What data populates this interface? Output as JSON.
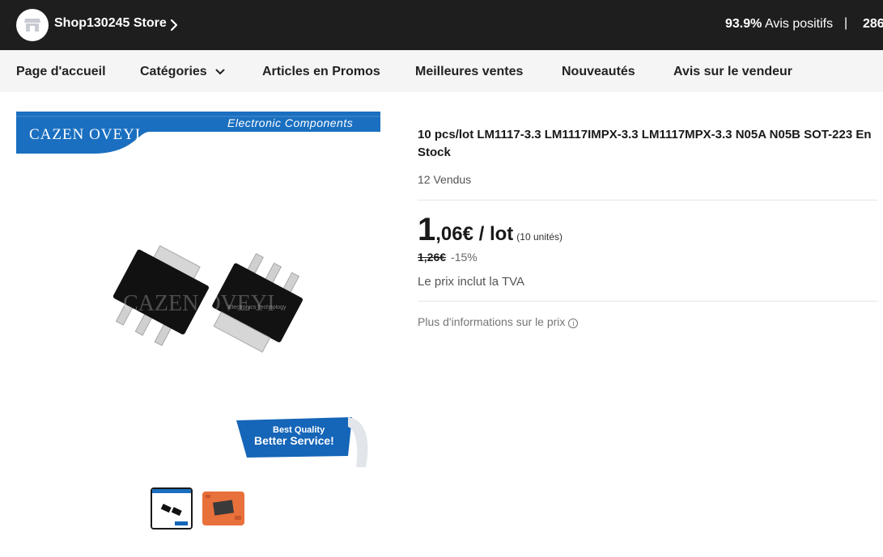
{
  "store": {
    "name": "Shop130245 Store",
    "positive_pct": "93.9%",
    "positive_label": "Avis positifs",
    "separator": "|",
    "followers_partial": "286"
  },
  "nav": {
    "items": [
      {
        "label": "Page d'accueil"
      },
      {
        "label": "Catégories"
      },
      {
        "label": "Articles en Promos"
      },
      {
        "label": "Meilleures ventes"
      },
      {
        "label": "Nouveautés"
      },
      {
        "label": "Avis sur le vendeur"
      }
    ]
  },
  "image": {
    "brand_logo": "CAZEN OVEYI",
    "banner_text": "Electronic Components",
    "watermark": "CAZEN OVEYI",
    "watermark_sub": "Electronics Technology",
    "badge_line1": "Best Quality",
    "badge_line2": "Better Service!"
  },
  "product": {
    "title": "10 pcs/lot LM1117-3.3 LM1117IMPX-3.3 LM1117MPX-3.3 N05A N05B SOT-223 En Stock",
    "sold": "12 Vendus",
    "price_int": "1",
    "price_rest": ",06€ / lot",
    "price_units": "(10 unités)",
    "original_price": "1,26€",
    "discount": "-15%",
    "vat_note": "Le prix inclut la TVA",
    "more_info": "Plus d'informations sur le prix"
  },
  "icons": {
    "store": "store-icon",
    "chevron": "chevron-right-icon",
    "caret": "chevron-down-icon",
    "info": "info-icon"
  },
  "colors": {
    "topbar_bg": "#1e1e1e",
    "nav_bg": "#f5f5f5",
    "banner_blue": "#1a6fc0",
    "badge_blue": "#1565b8"
  }
}
